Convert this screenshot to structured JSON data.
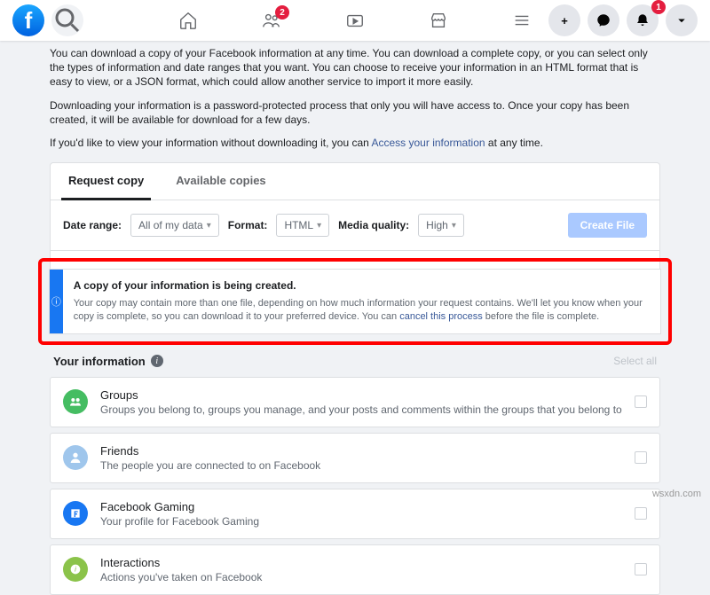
{
  "nav": {
    "friends_badge": "2",
    "notif_badge": "1"
  },
  "intro": {
    "p1a": "You can download a copy of your Facebook information at any time. You can download a complete copy, or you can select only the types of information and date ranges that you want. You can choose to receive your information in an HTML format that is easy to view, or a JSON format, which could allow another service to import it more easily.",
    "p2": "Downloading your information is a password-protected process that only you will have access to. Once your copy has been created, it will be available for download for a few days.",
    "p3a": "If you'd like to view your information without downloading it, you can ",
    "p3link": "Access your information",
    "p3b": " at any time."
  },
  "tabs": {
    "request": "Request copy",
    "available": "Available copies"
  },
  "filters": {
    "dr_label": "Date range:",
    "dr_val": "All of my data",
    "fmt_label": "Format:",
    "fmt_val": "HTML",
    "mq_label": "Media quality:",
    "mq_val": "High",
    "create": "Create File"
  },
  "notice": {
    "title": "A copy of your information is being created.",
    "body1": "Your copy may contain more than one file, depending on how much information your request contains. We'll let you know when your copy is complete, so you can download it to your preferred device. You can ",
    "link": "cancel this process",
    "body2": " before the file is complete."
  },
  "yi": {
    "title": "Your information",
    "selall": "Select all"
  },
  "items": [
    {
      "title": "Groups",
      "desc": "Groups you belong to, groups you manage, and your posts and comments within the groups that you belong to",
      "color": "#45bd62"
    },
    {
      "title": "Friends",
      "desc": "The people you are connected to on Facebook",
      "color": "#9fc6ec"
    },
    {
      "title": "Facebook Gaming",
      "desc": "Your profile for Facebook Gaming",
      "color": "#1877f2"
    },
    {
      "title": "Interactions",
      "desc": "Actions you've taken on Facebook",
      "color": "#8bc34a"
    }
  ],
  "watermark": "wsxdn.com"
}
